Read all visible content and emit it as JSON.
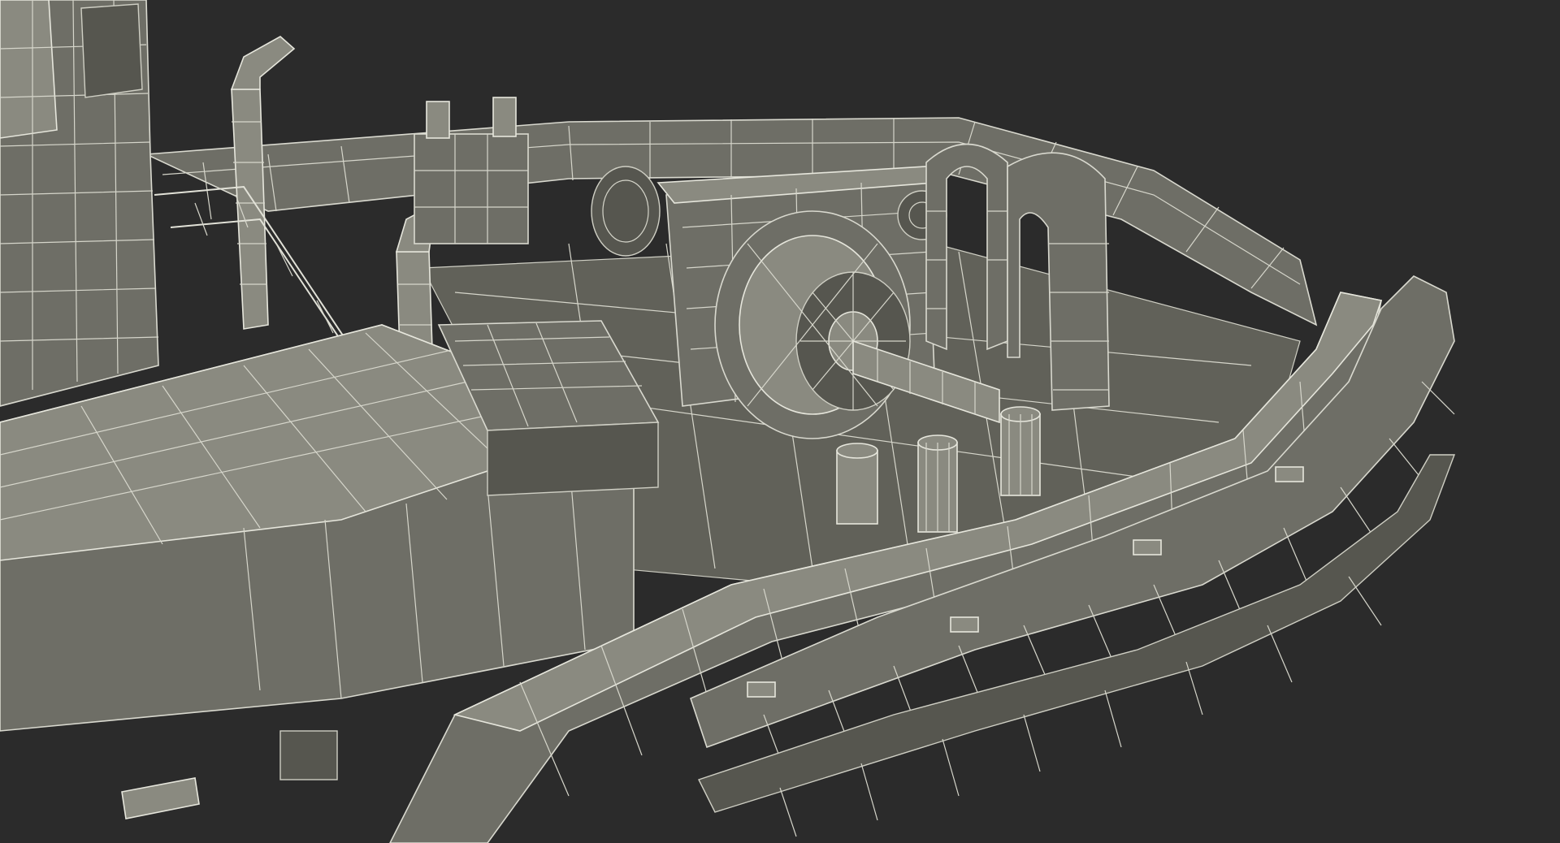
{
  "scene": {
    "subject": "tugboat-wireframe-render",
    "background_color": "#2b2b2b",
    "model_fill_color": "#6e6e66",
    "wire_color": "#d9d9cf"
  }
}
